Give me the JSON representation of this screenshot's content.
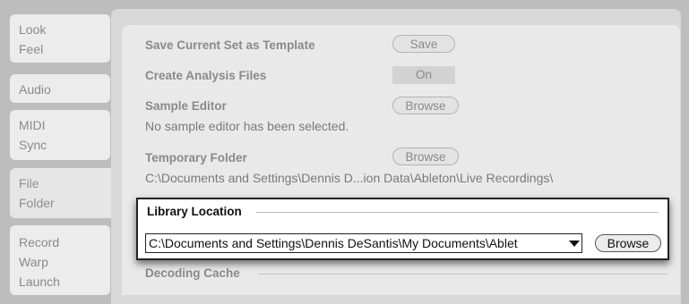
{
  "sidebar": {
    "tabs": [
      {
        "lines": [
          "Look",
          "Feel"
        ],
        "active": false
      },
      {
        "lines": [
          "Audio"
        ],
        "active": false
      },
      {
        "lines": [
          "MIDI",
          "Sync"
        ],
        "active": false
      },
      {
        "lines": [
          "File",
          "Folder"
        ],
        "active": true
      },
      {
        "lines": [
          "Record",
          "Warp",
          "Launch"
        ],
        "active": false
      }
    ]
  },
  "settings": {
    "save_template": {
      "label": "Save Current Set as Template",
      "button": "Save"
    },
    "analysis_files": {
      "label": "Create Analysis Files",
      "toggle": "On"
    },
    "sample_editor": {
      "label": "Sample Editor",
      "button": "Browse",
      "value": "No sample editor has been selected."
    },
    "temp_folder": {
      "label": "Temporary Folder",
      "button": "Browse",
      "value": "C:\\Documents and Settings\\Dennis D...ion Data\\Ableton\\Live Recordings\\"
    },
    "library_location": {
      "label": "Library Location",
      "path": "C:\\Documents and Settings\\Dennis DeSantis\\My Documents\\Ablet",
      "button": "Browse"
    },
    "decoding_cache": {
      "label": "Decoding Cache"
    }
  },
  "colors": {
    "highlight_border": "#222222",
    "background": "#bdbdbd"
  }
}
